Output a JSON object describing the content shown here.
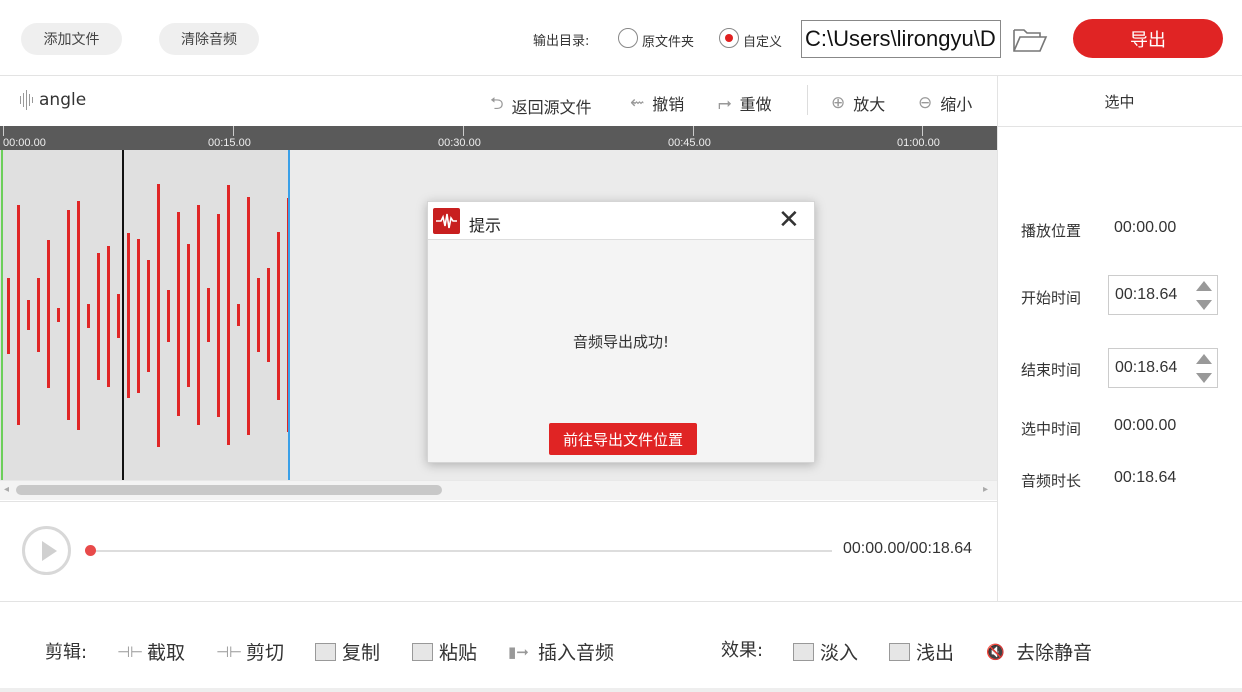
{
  "topbar": {
    "add_file": "添加文件",
    "clear_audio": "清除音频",
    "output_dir_label": "输出目录:",
    "radio_source": "原文件夹",
    "radio_custom": "自定义",
    "path_value": "C:\\Users\\lirongyu\\D",
    "export_label": "导出"
  },
  "toolbar": {
    "file_name": "angle",
    "revert": "返回源文件",
    "undo": "撤销",
    "redo": "重做",
    "zoom_in": "放大",
    "zoom_out": "缩小"
  },
  "ruler": {
    "ticks": [
      "00:00.00",
      "00:15.00",
      "00:30.00",
      "00:45.00",
      "01:00.00"
    ]
  },
  "right_panel": {
    "header": "选中",
    "play_position_label": "播放位置",
    "play_position_value": "00:00.00",
    "start_time_label": "开始时间",
    "start_time_value": "00:18.64",
    "end_time_label": "结束时间",
    "end_time_value": "00:18.64",
    "selected_time_label": "选中时间",
    "selected_time_value": "00:00.00",
    "duration_label": "音频时长",
    "duration_value": "00:18.64"
  },
  "player": {
    "time_readout": "00:00.00/00:18.64",
    "progress": 0
  },
  "bottom": {
    "edit_label": "剪辑:",
    "trim": "截取",
    "cut": "剪切",
    "copy": "复制",
    "paste": "粘贴",
    "insert_audio": "插入音频",
    "effects_label": "效果:",
    "fade_in": "淡入",
    "fade_out": "浅出",
    "remove_silence": "去除静音"
  },
  "dialog": {
    "title": "提示",
    "close": "✕",
    "message": "音频导出成功!",
    "action": "前往导出文件位置"
  },
  "colors": {
    "accent": "#e02424",
    "waveform": "#e02626",
    "selection_start": "#6ccf5a",
    "playhead": "#111111",
    "selection_end": "#3aa0e8"
  }
}
